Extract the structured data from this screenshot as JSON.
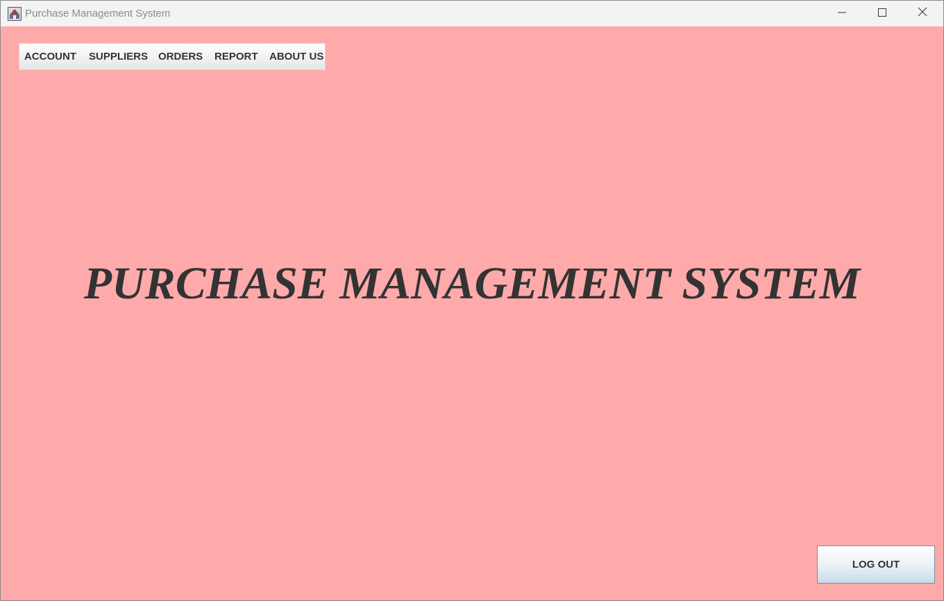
{
  "window": {
    "title": "Purchase Management System",
    "app_icon": "java-app-icon",
    "controls": {
      "minimize": "minimize-icon",
      "maximize": "maximize-icon",
      "close": "close-icon"
    }
  },
  "menu": {
    "items": [
      {
        "label": "ACCOUNT"
      },
      {
        "label": "SUPPLIERS"
      },
      {
        "label": "ORDERS"
      },
      {
        "label": "REPORT"
      },
      {
        "label": "ABOUT US"
      }
    ]
  },
  "main": {
    "heading": "PURCHASE MANAGEMENT SYSTEM"
  },
  "actions": {
    "logout_label": "LOG OUT"
  },
  "colors": {
    "background": "#ffaaaa",
    "titlebar": "#f3f3f3",
    "text": "#333333"
  }
}
